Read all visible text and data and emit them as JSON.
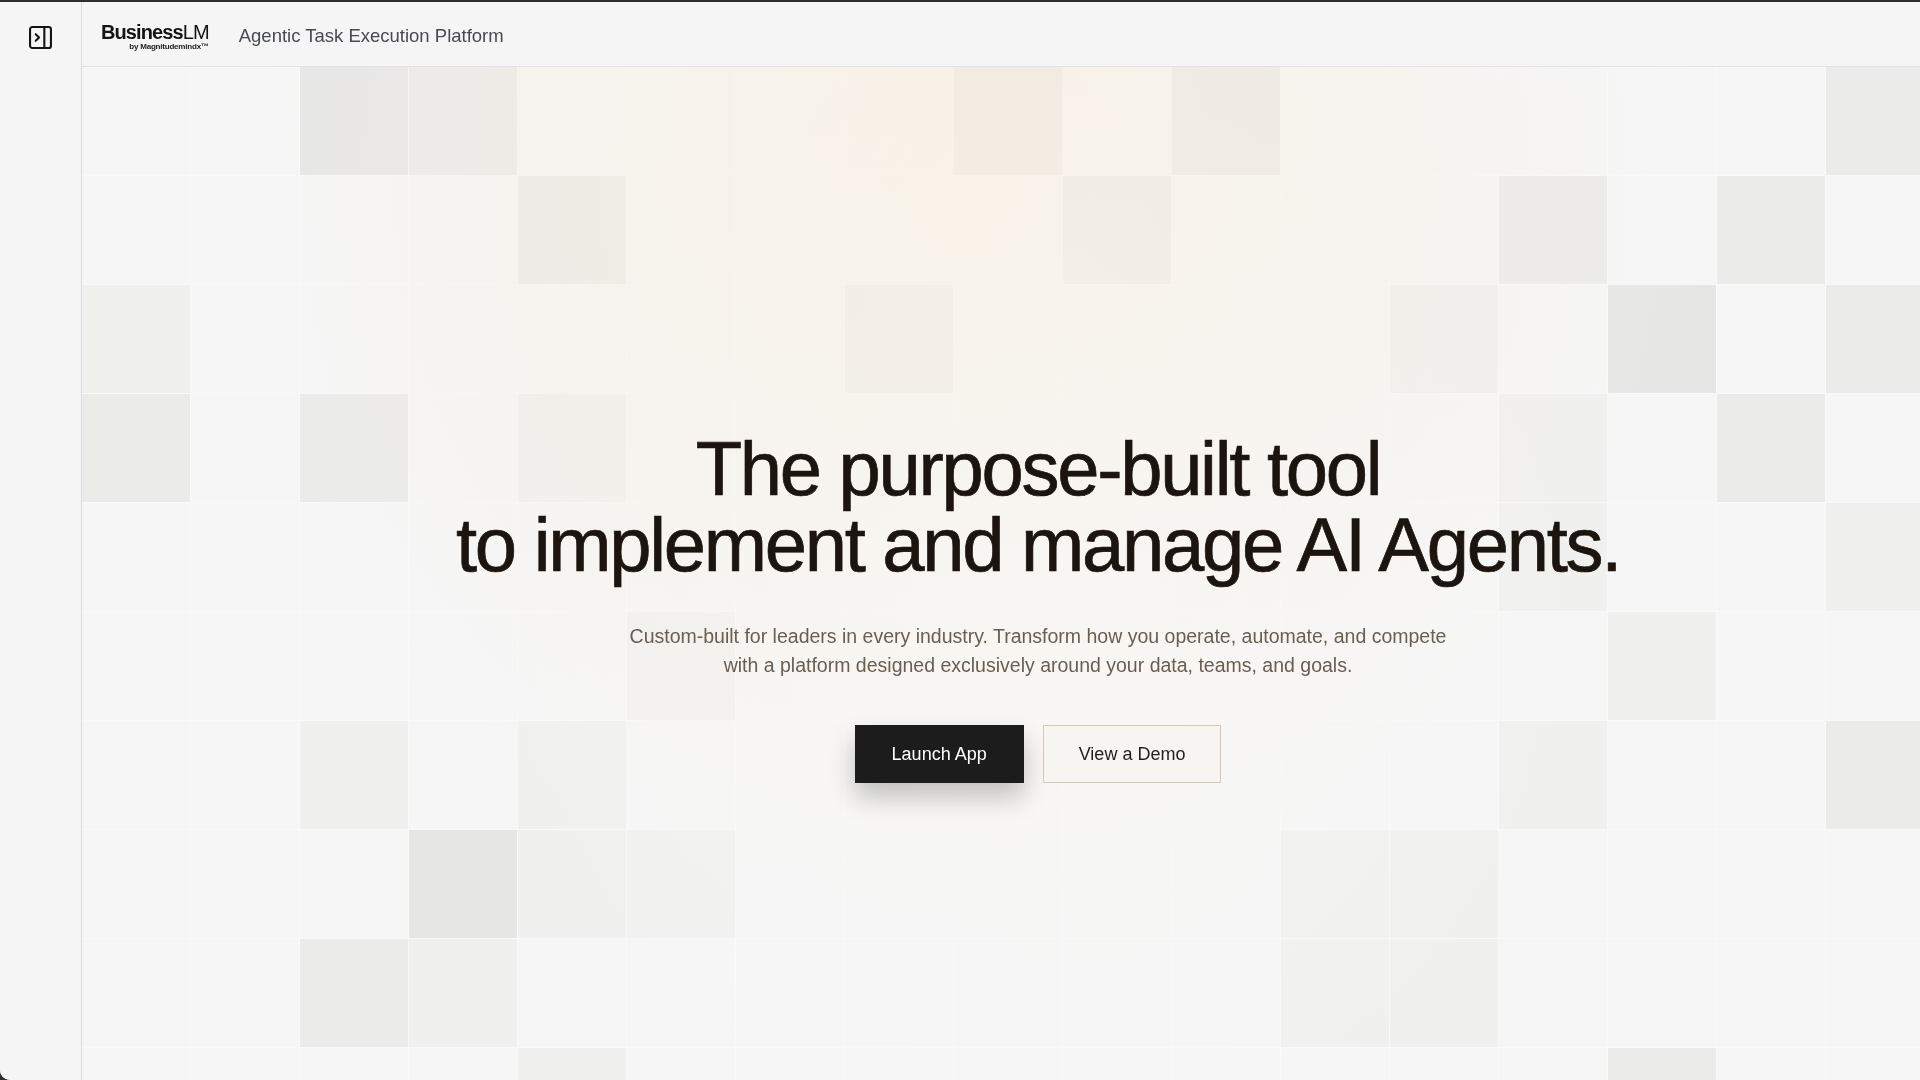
{
  "header": {
    "logo": {
      "wordmark": "**Business**LM",
      "byline": "by Magnitudemindx™"
    },
    "title": "Agentic Task Execution Platform"
  },
  "hero": {
    "headline": [
      "The purpose-built tool",
      "to implement and manage AI Agents."
    ],
    "subtitle": "Custom-built for leaders in every industry. Transform how you operate, automate, and compete with a platform designed exclusively around your data, teams, and goals.",
    "buttons": [
      {
        "label": "Launch App",
        "kind": "primary"
      },
      {
        "label": "View a Demo",
        "kind": "secondary"
      }
    ]
  }
}
